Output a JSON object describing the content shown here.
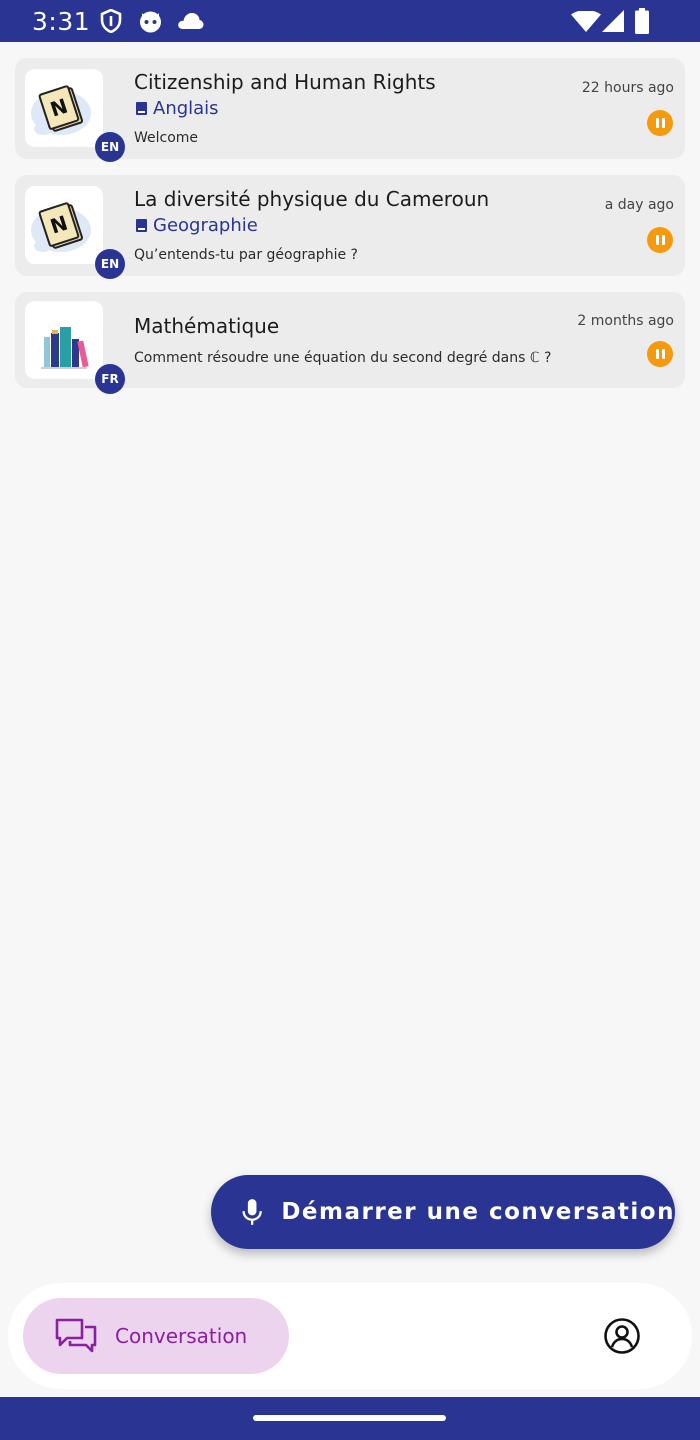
{
  "status_bar": {
    "time": "3:31",
    "icons": [
      "shield-icon",
      "cat-face-icon",
      "cloud-icon",
      "wifi-icon",
      "signal-icon",
      "battery-icon"
    ],
    "background": "#2a3593"
  },
  "conversations": [
    {
      "title": "Citizenship and Human Rights",
      "subject": "Anglais",
      "snippet": "Welcome",
      "time_ago": "22 hours ago",
      "language": "EN",
      "thumbnail_icon": "notebook-icon",
      "status_icon": "pause-icon"
    },
    {
      "title": "La diversité physique du Cameroun",
      "subject": "Geographie",
      "snippet": "Qu’entends-tu par géographie ?",
      "time_ago": "a day ago",
      "language": "EN",
      "thumbnail_icon": "notebook-icon",
      "status_icon": "pause-icon"
    },
    {
      "title": "Mathématique",
      "subject": "",
      "snippet": "Comment résoudre une équation du second degré dans ℂ ?",
      "time_ago": "2 months ago",
      "language": "FR",
      "thumbnail_icon": "books-icon",
      "status_icon": "pause-icon"
    }
  ],
  "fab": {
    "label": "Démarrer une conversation",
    "icon": "microphone-icon"
  },
  "bottom_nav": {
    "conversation_label": "Conversation",
    "conversation_icon": "chat-bubbles-icon",
    "profile_icon": "user-circle-icon"
  },
  "colors": {
    "primary": "#2a3593",
    "accent_orange": "#f59a0c",
    "nav_active_bg": "#ecd4ee",
    "nav_active_text": "#8b1fa3"
  }
}
